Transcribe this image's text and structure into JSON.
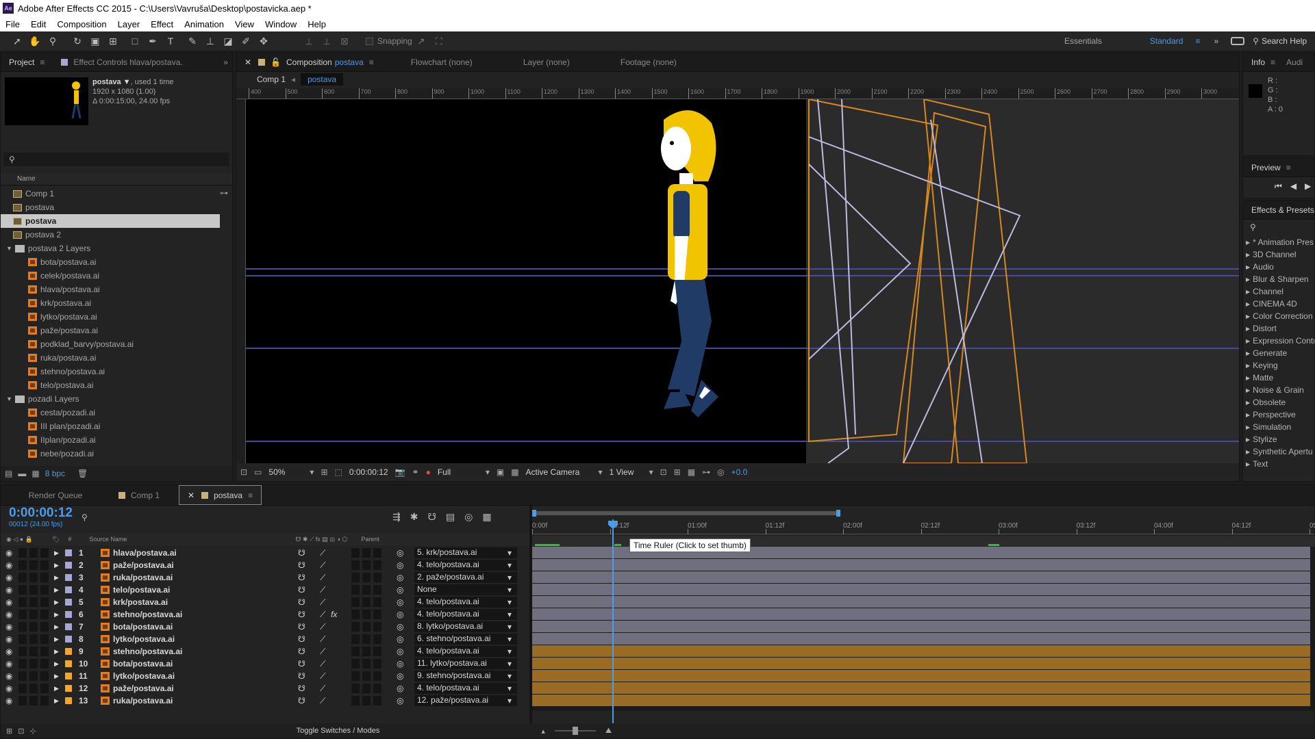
{
  "app": {
    "title": "Adobe After Effects CC 2015 - C:\\Users\\Vavruša\\Desktop\\postavicka.aep *",
    "icon": "Ae"
  },
  "menu": [
    "File",
    "Edit",
    "Composition",
    "Layer",
    "Effect",
    "Animation",
    "View",
    "Window",
    "Help"
  ],
  "toolbar": {
    "snapping": "Snapping",
    "workspace1": "Essentials",
    "workspace2": "Standard",
    "search_help": "Search Help"
  },
  "project": {
    "tab": "Project",
    "tab2": "Effect Controls hlava/postava.",
    "item_name": "postava ▼",
    "used": ", used 1 time",
    "dims": "1920 x 1080 (1.00)",
    "duration": "Δ 0:00:15:00, 24.00 fps",
    "col_name": "Name",
    "bpc": "8 bpc",
    "items": [
      {
        "label": "Comp 1",
        "type": "comp",
        "indent": 0
      },
      {
        "label": "postava",
        "type": "comp",
        "indent": 0
      },
      {
        "label": "postava",
        "type": "comp",
        "indent": 0,
        "selected": true
      },
      {
        "label": "postava 2",
        "type": "comp",
        "indent": 0
      },
      {
        "label": "postava 2 Layers",
        "type": "folder",
        "indent": 0
      },
      {
        "label": "bota/postava.ai",
        "type": "ai",
        "indent": 1
      },
      {
        "label": "celek/postava.ai",
        "type": "ai",
        "indent": 1
      },
      {
        "label": "hlava/postava.ai",
        "type": "ai",
        "indent": 1
      },
      {
        "label": "krk/postava.ai",
        "type": "ai",
        "indent": 1
      },
      {
        "label": "lytko/postava.ai",
        "type": "ai",
        "indent": 1
      },
      {
        "label": "paže/postava.ai",
        "type": "ai",
        "indent": 1
      },
      {
        "label": "podklad_barvy/postava.ai",
        "type": "ai",
        "indent": 1
      },
      {
        "label": "ruka/postava.ai",
        "type": "ai",
        "indent": 1
      },
      {
        "label": "stehno/postava.ai",
        "type": "ai",
        "indent": 1
      },
      {
        "label": "telo/postava.ai",
        "type": "ai",
        "indent": 1
      },
      {
        "label": "pozadi Layers",
        "type": "folder",
        "indent": 0
      },
      {
        "label": "cesta/pozadi.ai",
        "type": "ai",
        "indent": 1
      },
      {
        "label": "III plan/pozadi.ai",
        "type": "ai",
        "indent": 1
      },
      {
        "label": "IIplan/pozadi.ai",
        "type": "ai",
        "indent": 1
      },
      {
        "label": "nebe/pozadi.ai",
        "type": "ai",
        "indent": 1
      }
    ]
  },
  "comp": {
    "tab_prefix": "Composition",
    "tab_name": "postava",
    "tab2": "Flowchart (none)",
    "tab3": "Layer (none)",
    "tab4": "Footage (none)",
    "crumb1": "Comp 1",
    "crumb2": "postava",
    "ruler": [
      "400",
      "500",
      "600",
      "700",
      "800",
      "900",
      "1000",
      "1100",
      "1200",
      "1300",
      "1400",
      "1500",
      "1600",
      "1700",
      "1800",
      "1900",
      "2000",
      "2100",
      "2200",
      "2300",
      "2400",
      "2500",
      "2600",
      "2700",
      "2800",
      "2900",
      "3000"
    ],
    "zoom": "50%",
    "time": "0:00:00:12",
    "resolution": "Full",
    "camera": "Active Camera",
    "views": "1 View",
    "exposure": "+0.0"
  },
  "info": {
    "tab": "Info",
    "tab2": "Audi",
    "r": "R :",
    "g": "G :",
    "b": "B :",
    "a": "A : 0"
  },
  "preview": {
    "tab": "Preview"
  },
  "effects": {
    "tab": "Effects & Presets",
    "items": [
      "* Animation Pres",
      "3D Channel",
      "Audio",
      "Blur & Sharpen",
      "Channel",
      "CINEMA 4D",
      "Color Correction",
      "Distort",
      "Expression Contr",
      "Generate",
      "Keying",
      "Matte",
      "Noise & Grain",
      "Obsolete",
      "Perspective",
      "Simulation",
      "Stylize",
      "Synthetic Apertu",
      "Text"
    ]
  },
  "timeline": {
    "tabs": [
      "Render Queue",
      "Comp 1",
      "postava"
    ],
    "timecode": "0:00:00:12",
    "frames": "00012 (24.00 fps)",
    "col_source": "Source Name",
    "col_parent": "Parent",
    "toggle": "Toggle Switches / Modes",
    "tooltip": "Time Ruler (Click to set thumb)",
    "ruler": [
      "0:00f",
      "00:12f",
      "01:00f",
      "01:12f",
      "02:00f",
      "02:12f",
      "03:00f",
      "03:12f",
      "04:00f",
      "04:12f",
      "05:0"
    ],
    "layers": [
      {
        "num": "1",
        "name": "hlava/postava.ai",
        "parent": "5. krk/postava.ai",
        "color": "#a7a7d6",
        "fx": false
      },
      {
        "num": "2",
        "name": "paže/postava.ai",
        "parent": "4. telo/postava.ai",
        "color": "#a7a7d6",
        "fx": false
      },
      {
        "num": "3",
        "name": "ruka/postava.ai",
        "parent": "2. paže/postava.ai",
        "color": "#a7a7d6",
        "fx": false
      },
      {
        "num": "4",
        "name": "telo/postava.ai",
        "parent": "None",
        "color": "#a7a7d6",
        "fx": false
      },
      {
        "num": "5",
        "name": "krk/postava.ai",
        "parent": "4. telo/postava.ai",
        "color": "#a7a7d6",
        "fx": false
      },
      {
        "num": "6",
        "name": "stehno/postava.ai",
        "parent": "4. telo/postava.ai",
        "color": "#a7a7d6",
        "fx": true
      },
      {
        "num": "7",
        "name": "bota/postava.ai",
        "parent": "8. lytko/postava.ai",
        "color": "#a7a7d6",
        "fx": false
      },
      {
        "num": "8",
        "name": "lytko/postava.ai",
        "parent": "6. stehno/postava.ai",
        "color": "#a7a7d6",
        "fx": false
      },
      {
        "num": "9",
        "name": "stehno/postava.ai",
        "parent": "4. telo/postava.ai",
        "color": "#f5a623",
        "fx": false
      },
      {
        "num": "10",
        "name": "bota/postava.ai",
        "parent": "11. lytko/postava.ai",
        "color": "#f5a623",
        "fx": false
      },
      {
        "num": "11",
        "name": "lytko/postava.ai",
        "parent": "9. stehno/postava.ai",
        "color": "#f5a623",
        "fx": false
      },
      {
        "num": "12",
        "name": "paže/postava.ai",
        "parent": "4. telo/postava.ai",
        "color": "#f5a623",
        "fx": false
      },
      {
        "num": "13",
        "name": "ruka/postava.ai",
        "parent": "12. paže/postava.ai",
        "color": "#f5a623",
        "fx": false
      }
    ]
  }
}
